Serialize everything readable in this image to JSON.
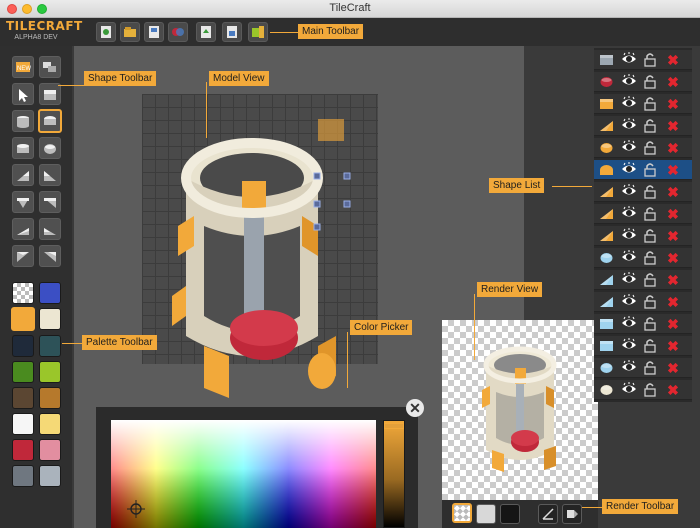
{
  "window": {
    "title": "TileCraft"
  },
  "logo": {
    "name": "TILECRAFT",
    "version": "ALPHA8 DEV"
  },
  "main_toolbar": {
    "buttons": [
      {
        "name": "new-icon"
      },
      {
        "name": "open-icon"
      },
      {
        "name": "save-icon"
      },
      {
        "name": "import-icon"
      },
      {
        "name": "export-icon"
      },
      {
        "name": "export-png-icon"
      },
      {
        "name": "settings-icon"
      }
    ]
  },
  "shape_toolbar": {
    "buttons": [
      {
        "name": "new-shape-icon"
      },
      {
        "name": "duplicate-shape-icon"
      },
      {
        "name": "pointer-icon"
      },
      {
        "name": "cube-icon"
      },
      {
        "name": "cylinder-v-icon"
      },
      {
        "name": "cylinder-h-icon"
      },
      {
        "name": "cylinder-side-icon"
      },
      {
        "name": "sphere-icon"
      },
      {
        "name": "prism-a-icon"
      },
      {
        "name": "prism-b-icon"
      },
      {
        "name": "prism-c-icon"
      },
      {
        "name": "prism-d-icon"
      },
      {
        "name": "wedge-a-icon"
      },
      {
        "name": "wedge-b-icon"
      },
      {
        "name": "wedge-c-icon"
      },
      {
        "name": "wedge-d-icon"
      }
    ]
  },
  "palette": {
    "colors": [
      "transparent",
      "#3b4fc4",
      "#f2a93a",
      "#ece6d2",
      "#1f2a3a",
      "#2d5258",
      "#4a8b1f",
      "#9ac62a",
      "#5b4632",
      "#b6792c",
      "#f6f6f6",
      "#f5d976",
      "#c0283a",
      "#e28ea0",
      "#6f7780",
      "#aab3bc"
    ]
  },
  "color_picker": {
    "close_label": "✕"
  },
  "render_toolbar": {
    "buttons": [
      {
        "name": "checker-bg-icon"
      },
      {
        "name": "light-bg-icon"
      },
      {
        "name": "dark-bg-icon"
      },
      {
        "name": "camera-angle-icon"
      },
      {
        "name": "render-export-icon"
      }
    ]
  },
  "shape_list": {
    "items": [
      {
        "shape": "cube",
        "color": "#9ca7b1"
      },
      {
        "shape": "cylinder",
        "color": "#c0283a"
      },
      {
        "shape": "cube",
        "color": "#f2a93a"
      },
      {
        "shape": "wedge",
        "color": "#f2a93a"
      },
      {
        "shape": "cylinder",
        "color": "#f2a93a"
      },
      {
        "shape": "cylinder-half",
        "color": "#f2a93a",
        "selected": true
      },
      {
        "shape": "wedge",
        "color": "#f2a93a"
      },
      {
        "shape": "wedge",
        "color": "#f2a93a"
      },
      {
        "shape": "wedge",
        "color": "#f2a93a"
      },
      {
        "shape": "cylinder",
        "color": "#9fd3ee"
      },
      {
        "shape": "wedge",
        "color": "#9fd3ee"
      },
      {
        "shape": "wedge",
        "color": "#9fd3ee"
      },
      {
        "shape": "cube",
        "color": "#9fd3ee"
      },
      {
        "shape": "cube",
        "color": "#9fd3ee"
      },
      {
        "shape": "cylinder",
        "color": "#9fd3ee"
      },
      {
        "shape": "cylinder",
        "color": "#ece6d2"
      }
    ],
    "delete_label": "✖"
  },
  "callouts": {
    "main_toolbar": "Main Toolbar",
    "shape_toolbar": "Shape Toolbar",
    "model_view": "Model View",
    "shape_list": "Shape List",
    "render_view": "Render View",
    "color_picker": "Color Picker",
    "palette_toolbar": "Palette Toolbar",
    "render_toolbar": "Render Toolbar"
  },
  "colors": {
    "accent": "#f2a93a",
    "selection": "#1d4f86",
    "delete": "#e3262f"
  }
}
